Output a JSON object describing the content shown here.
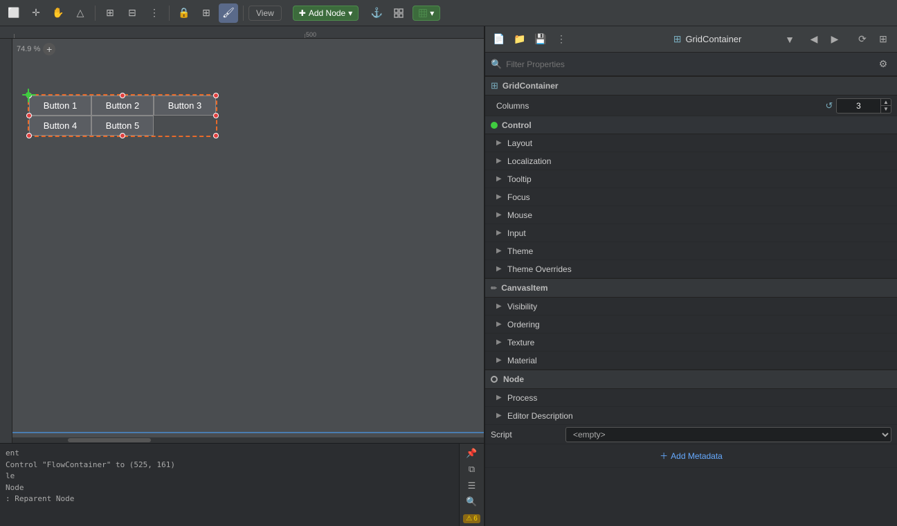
{
  "toolbar": {
    "buttons": [
      {
        "id": "select",
        "icon": "⬜",
        "title": "Select Mode",
        "active": false
      },
      {
        "id": "move",
        "icon": "✛",
        "title": "Move",
        "active": false
      },
      {
        "id": "hand",
        "icon": "✋",
        "title": "Pan",
        "active": false
      },
      {
        "id": "ruler",
        "icon": "📐",
        "title": "Ruler",
        "active": false
      },
      {
        "id": "anchor",
        "icon": "⊞",
        "title": "Anchor",
        "active": false
      },
      {
        "id": "grid",
        "icon": "⊟",
        "title": "Grid",
        "active": false
      },
      {
        "id": "more",
        "icon": "⋮",
        "title": "More",
        "active": false
      },
      {
        "id": "lock",
        "icon": "🔒",
        "title": "Lock",
        "active": false
      },
      {
        "id": "snap",
        "icon": "⊞",
        "title": "Snap",
        "active": false
      },
      {
        "id": "pin",
        "icon": "📌",
        "title": "Pin",
        "active": false
      },
      {
        "id": "paint",
        "icon": "🖌",
        "title": "Paint",
        "active": true
      }
    ],
    "view_label": "View",
    "add_label": "Add Node",
    "anchor_label": "Anchor",
    "grid_label": "Grid Layout"
  },
  "canvas": {
    "zoom": "74.9 %",
    "ruler_ticks": [
      "",
      "500"
    ],
    "buttons": [
      {
        "id": "b1",
        "label": "Button 1"
      },
      {
        "id": "b2",
        "label": "Button 2"
      },
      {
        "id": "b3",
        "label": "Button 3"
      },
      {
        "id": "b4",
        "label": "Button 4"
      },
      {
        "id": "b5",
        "label": "Button 5"
      }
    ]
  },
  "log": {
    "lines": [
      "ent",
      "Control \"FlowContainer\" to (525, 161)",
      "le",
      "Node",
      ": Reparent Node"
    ],
    "warning_count": "6"
  },
  "right_panel": {
    "header": {
      "title": "GridContainer",
      "icon": "⊞"
    },
    "filter_placeholder": "Filter Properties",
    "section_grid_container": "GridContainer",
    "columns_label": "Columns",
    "columns_value": "3",
    "control_label": "Control",
    "properties": [
      {
        "label": "Layout"
      },
      {
        "label": "Localization"
      },
      {
        "label": "Tooltip"
      },
      {
        "label": "Focus"
      },
      {
        "label": "Mouse"
      },
      {
        "label": "Input"
      },
      {
        "label": "Theme"
      },
      {
        "label": "Theme Overrides"
      }
    ],
    "canvas_item_label": "CanvasItem",
    "canvas_item_props": [
      {
        "label": "Visibility"
      },
      {
        "label": "Ordering"
      },
      {
        "label": "Texture"
      },
      {
        "label": "Material"
      }
    ],
    "node_label": "Node",
    "node_props": [
      {
        "label": "Process"
      },
      {
        "label": "Editor Description"
      }
    ],
    "script_label": "Script",
    "script_value": "<empty>",
    "add_metadata_label": "Add Metadata"
  }
}
